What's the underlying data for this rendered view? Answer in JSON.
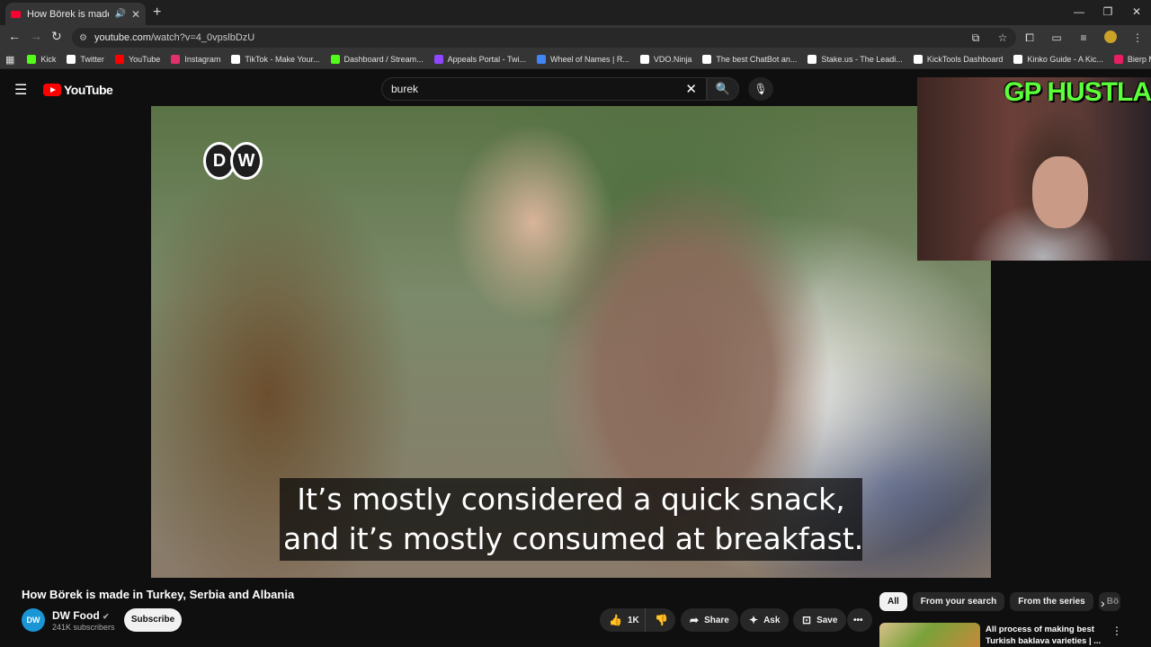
{
  "browser": {
    "tab_title": "How Börek is made in Turke",
    "url_host": "youtube.com",
    "url_path": "/watch?v=4_0vpslbDzU",
    "bookmarks": [
      {
        "label": "Kick",
        "color": "#53fc18"
      },
      {
        "label": "Twitter",
        "color": "#ffffff"
      },
      {
        "label": "YouTube",
        "color": "#ff0000"
      },
      {
        "label": "Instagram",
        "color": "#e1306c"
      },
      {
        "label": "TikTok - Make Your...",
        "color": "#ffffff"
      },
      {
        "label": "Dashboard / Stream...",
        "color": "#53fc18"
      },
      {
        "label": "Appeals Portal - Twi...",
        "color": "#9146ff"
      },
      {
        "label": "Wheel of Names | R...",
        "color": "#4285f4"
      },
      {
        "label": "VDO.Ninja",
        "color": "#ffffff"
      },
      {
        "label": "The best ChatBot an...",
        "color": "#ffffff"
      },
      {
        "label": "Stake.us - The Leadi...",
        "color": "#ffffff"
      },
      {
        "label": "KickTools Dashboard",
        "color": "#ffffff"
      },
      {
        "label": "Kinko Guide - A Kic...",
        "color": "#ffffff"
      },
      {
        "label": "Bierp Memes | Best...",
        "color": "#e91e63"
      }
    ]
  },
  "youtube": {
    "logo_text": "YouTube",
    "search_value": "burek",
    "video": {
      "watermark": "DW",
      "subtitle_line1": "It’s mostly considered a quick snack,",
      "subtitle_line2": "and it’s mostly consumed at breakfast."
    },
    "webcam_overlay_text": "GP HUSTLA",
    "title": "How Börek is made in Turkey, Serbia and Albania",
    "channel": {
      "name": "DW Food",
      "avatar_text": "DW",
      "subscribers": "241K subscribers",
      "subscribe_label": "Subscribe"
    },
    "actions": {
      "likes": "1K",
      "share": "Share",
      "ask": "Ask",
      "save": "Save"
    },
    "chips": [
      "All",
      "From your search",
      "From the series",
      "Bö"
    ],
    "recommendation": {
      "title": "All process of making best Turkish baklava varieties | ..."
    }
  }
}
